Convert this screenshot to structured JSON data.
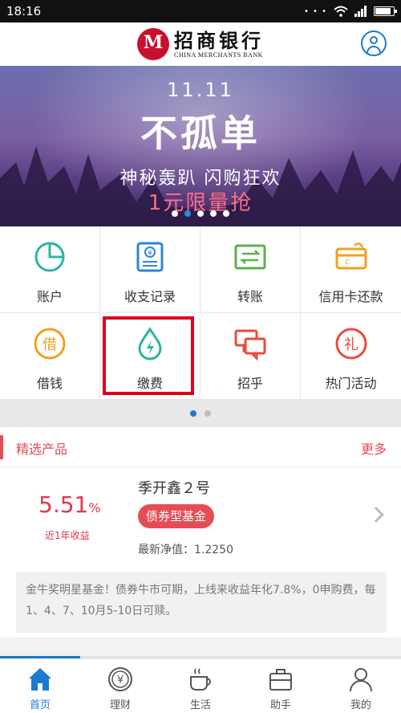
{
  "status": {
    "time": "18:16"
  },
  "header": {
    "brand_cn": "招商银行",
    "brand_en": "CHINA MERCHANTS BANK"
  },
  "banner": {
    "date": "11.11",
    "title": "不孤单",
    "subtitle": "神秘轰趴 闪购狂欢",
    "promo": "1元限量抢"
  },
  "grid": [
    {
      "label": "账户",
      "icon": "pie-chart-icon"
    },
    {
      "label": "收支记录",
      "icon": "receipt-icon"
    },
    {
      "label": "转账",
      "icon": "transfer-icon"
    },
    {
      "label": "信用卡还款",
      "icon": "credit-card-icon"
    },
    {
      "label": "借钱",
      "icon": "borrow-icon"
    },
    {
      "label": "缴费",
      "icon": "water-drop-icon"
    },
    {
      "label": "招乎",
      "icon": "chat-bubbles-icon"
    },
    {
      "label": "热门活动",
      "icon": "gift-icon"
    }
  ],
  "section": {
    "title": "精选产品",
    "more": "更多"
  },
  "product": {
    "rate": "5.51",
    "rate_unit": "%",
    "rate_label": "近1年收益",
    "name": "季开鑫２号",
    "tag": "债券型基金",
    "nav": "最新净值：1.2250",
    "desc": "金牛奖明星基金！债券牛市可期，上线来收益年化7.8%，0申购费，每1、4、7、10月5-10日可赎。"
  },
  "tabs": [
    {
      "label": "首页",
      "icon": "home-icon"
    },
    {
      "label": "理财",
      "icon": "yen-coin-icon"
    },
    {
      "label": "生活",
      "icon": "coffee-cup-icon"
    },
    {
      "label": "助手",
      "icon": "briefcase-icon"
    },
    {
      "label": "我的",
      "icon": "person-icon"
    }
  ],
  "colors": {
    "accent": "#1a7bd1",
    "red": "#e74c56",
    "brand_red": "#c8102e"
  }
}
